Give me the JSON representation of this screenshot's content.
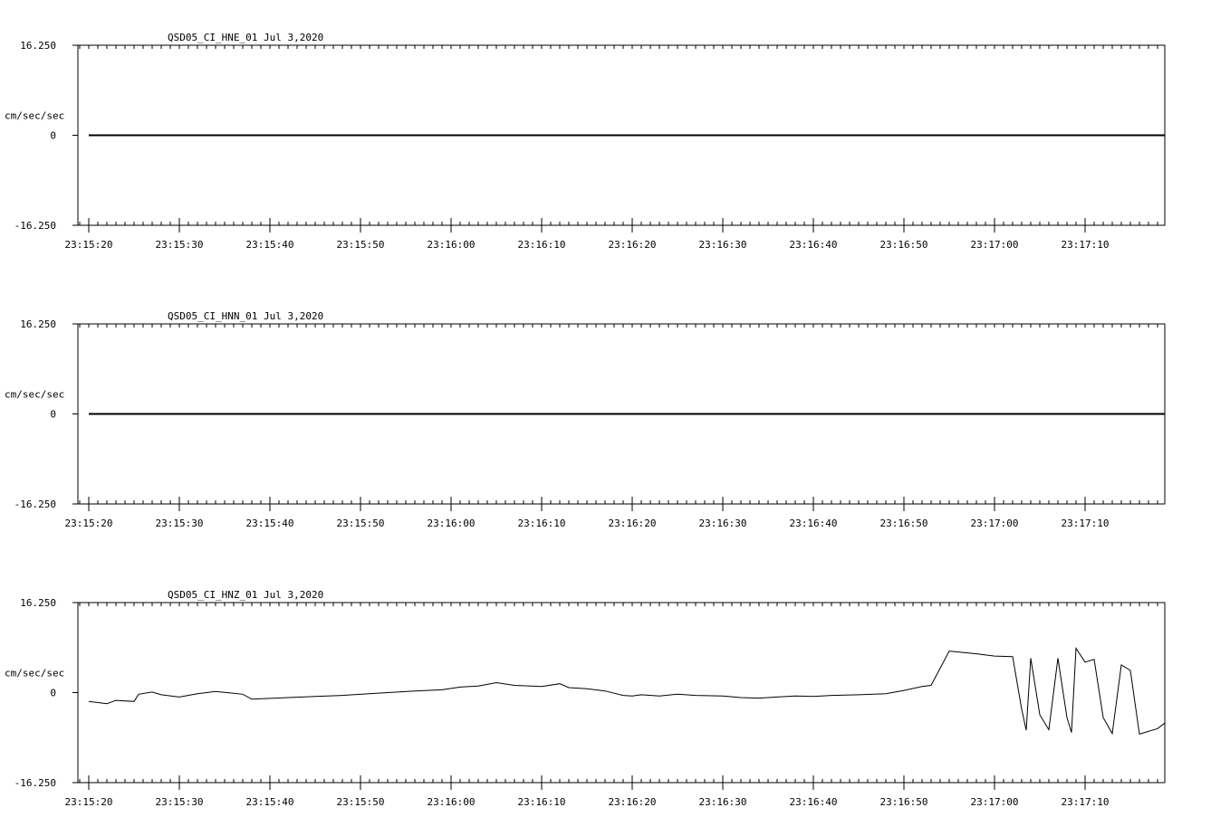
{
  "chart_data": [
    {
      "type": "line",
      "title": "QSD05_CI_HNE_01  Jul 3,2020",
      "ylabel": "cm/sec/sec",
      "yticks": [
        "16.250",
        "0",
        "-16.250"
      ],
      "ylim": [
        -16.25,
        16.25
      ],
      "xlim_seconds": [
        -1.2,
        118.8
      ],
      "xticks": [
        "23:15:20",
        "23:15:30",
        "23:15:40",
        "23:15:50",
        "23:16:00",
        "23:16:10",
        "23:16:20",
        "23:16:30",
        "23:16:40",
        "23:16:50",
        "23:17:00",
        "23:17:10"
      ],
      "grid": false,
      "series": [
        {
          "x": [
            0,
            118.8
          ],
          "values": [
            0,
            0
          ]
        }
      ]
    },
    {
      "type": "line",
      "title": "QSD05_CI_HNN_01  Jul 3,2020",
      "ylabel": "cm/sec/sec",
      "yticks": [
        "16.250",
        "0",
        "-16.250"
      ],
      "ylim": [
        -16.25,
        16.25
      ],
      "xlim_seconds": [
        -1.2,
        118.8
      ],
      "xticks": [
        "23:15:20",
        "23:15:30",
        "23:15:40",
        "23:15:50",
        "23:16:00",
        "23:16:10",
        "23:16:20",
        "23:16:30",
        "23:16:40",
        "23:16:50",
        "23:17:00",
        "23:17:10"
      ],
      "grid": false,
      "series": [
        {
          "x": [
            0,
            118.8
          ],
          "values": [
            0,
            0
          ]
        }
      ]
    },
    {
      "type": "line",
      "title": "QSD05_CI_HNZ_01  Jul 3,2020",
      "ylabel": "cm/sec/sec",
      "yticks": [
        "16.250",
        "0",
        "-16.250"
      ],
      "ylim": [
        -16.25,
        16.25
      ],
      "xlim_seconds": [
        -1.2,
        118.8
      ],
      "xticks": [
        "23:15:20",
        "23:15:30",
        "23:15:40",
        "23:15:50",
        "23:16:00",
        "23:16:10",
        "23:16:20",
        "23:16:30",
        "23:16:40",
        "23:16:50",
        "23:17:00",
        "23:17:10"
      ],
      "grid": false,
      "series": [
        {
          "x": [
            0,
            2,
            3,
            5,
            5.5,
            7,
            8,
            10,
            12,
            14,
            17,
            18,
            22,
            25,
            28,
            33,
            36,
            39,
            41,
            43,
            45,
            47,
            50,
            52,
            53,
            55,
            57,
            59,
            60,
            61,
            63,
            65,
            67,
            70,
            72,
            74,
            76,
            78,
            80,
            82,
            85,
            88,
            90,
            92,
            93,
            95,
            98,
            100,
            102,
            103,
            103.5,
            104,
            105,
            106,
            107,
            108,
            108.5,
            109,
            110,
            111,
            112,
            113,
            114,
            115,
            116,
            117,
            118,
            118.8
          ],
          "values": [
            -1.6,
            -2.0,
            -1.4,
            -1.6,
            -0.3,
            0.1,
            -0.4,
            -0.8,
            -0.2,
            0.2,
            -0.3,
            -1.2,
            -0.9,
            -0.7,
            -0.5,
            0.0,
            0.3,
            0.5,
            1.0,
            1.2,
            1.8,
            1.3,
            1.1,
            1.6,
            0.9,
            0.7,
            0.3,
            -0.5,
            -0.6,
            -0.4,
            -0.6,
            -0.3,
            -0.5,
            -0.6,
            -0.9,
            -1.0,
            -0.8,
            -0.6,
            -0.7,
            -0.5,
            -0.4,
            -0.2,
            0.4,
            1.1,
            1.3,
            7.5,
            7.0,
            6.6,
            6.5,
            -3.0,
            -6.8,
            6.2,
            -4.0,
            -6.7,
            6.2,
            -4.5,
            -7.2,
            8.0,
            5.5,
            6.0,
            -4.5,
            -7.4,
            5.0,
            4.0,
            -7.5,
            -7.0,
            -6.5,
            -5.5
          ]
        }
      ]
    }
  ]
}
